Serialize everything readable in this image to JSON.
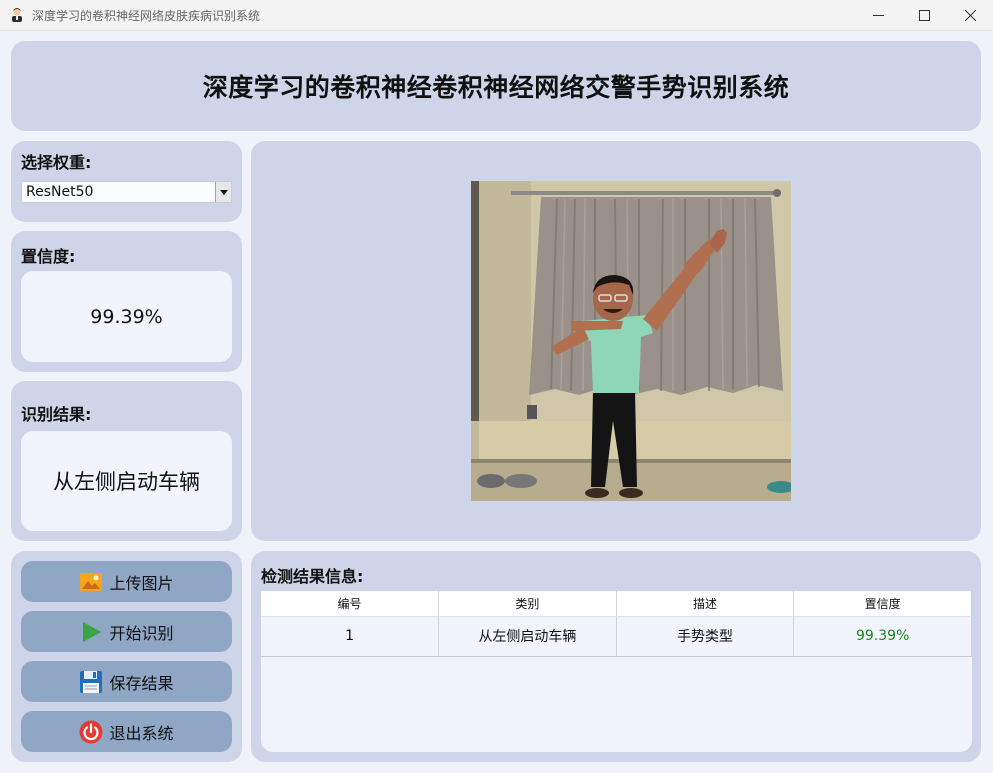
{
  "window": {
    "title": "深度学习的卷积神经网络皮肤疾病识别系统",
    "controls": [
      "minimize",
      "maximize",
      "close"
    ]
  },
  "header": {
    "title": "深度学习的卷积神经卷积神经网络交警手势识别系统"
  },
  "weight": {
    "label": "选择权重:",
    "selected": "ResNet50"
  },
  "confidence": {
    "label": "置信度:",
    "value": "99.39%"
  },
  "result": {
    "label": "识别结果:",
    "value": "从左侧启动车辆"
  },
  "actions": {
    "upload": {
      "label": "上传图片",
      "icon": "image-icon"
    },
    "start": {
      "label": "开始识别",
      "icon": "play-icon"
    },
    "save": {
      "label": "保存结果",
      "icon": "floppy-disk-icon"
    },
    "exit": {
      "label": "退出系统",
      "icon": "power-icon"
    }
  },
  "detection": {
    "label": "检测结果信息:",
    "columns": [
      "编号",
      "类别",
      "描述",
      "置信度"
    ],
    "rows": [
      {
        "id": "1",
        "category": "从左侧启动车辆",
        "description": "手势类型",
        "confidence": "99.39%"
      }
    ]
  },
  "colors": {
    "panel": "#cfd5e8",
    "background": "#f0f2fa",
    "button": "#8fa6c4",
    "confidence_text": "#1a8a1a",
    "exit_icon": "#e53935",
    "play_icon": "#3aa346"
  }
}
